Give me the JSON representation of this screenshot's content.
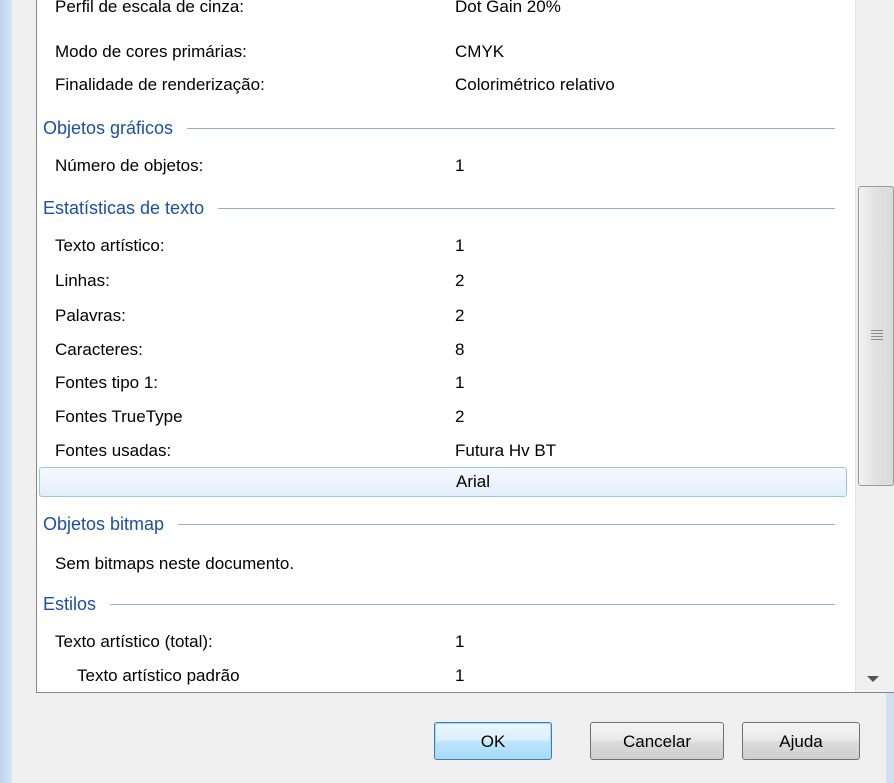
{
  "properties": {
    "rows_top": [
      {
        "label": "Perfil de escala de cinza:",
        "value": "Dot Gain 20%"
      },
      {
        "label": "Modo de cores primárias:",
        "value": "CMYK"
      },
      {
        "label": "Finalidade de renderização:",
        "value": "Colorimétrico relativo"
      }
    ],
    "sections": {
      "graphic_objects": "Objetos gráficos",
      "text_stats": "Estatísticas de texto",
      "bitmap_objects": "Objetos bitmap",
      "styles": "Estilos"
    },
    "graphic_objects": [
      {
        "label": "Número de objetos:",
        "value": "1"
      }
    ],
    "text_stats": [
      {
        "label": "Texto artístico:",
        "value": "1"
      },
      {
        "label": "Linhas:",
        "value": "2"
      },
      {
        "label": "Palavras:",
        "value": "2"
      },
      {
        "label": "Caracteres:",
        "value": "8"
      },
      {
        "label": "Fontes tipo 1:",
        "value": "1"
      },
      {
        "label": "Fontes TrueType",
        "value": "2"
      },
      {
        "label": "Fontes usadas:",
        "value": "Futura Hv BT"
      },
      {
        "label": "",
        "value": "Arial"
      }
    ],
    "bitmap_objects": {
      "message": "Sem bitmaps neste documento."
    },
    "styles": [
      {
        "label": "Texto artístico (total):",
        "value": "1"
      },
      {
        "label": "Texto artístico padrão",
        "value": "1"
      }
    ]
  },
  "buttons": {
    "ok": "OK",
    "cancel": "Cancelar",
    "help": "Ajuda"
  },
  "colors": {
    "section_header": "#1c4fa6",
    "selection_border": "#99c6ee",
    "default_button_border": "#3c7fb1"
  },
  "icons": {
    "scroll_grip": "grip-icon",
    "scroll_down": "chevron-down-icon"
  }
}
